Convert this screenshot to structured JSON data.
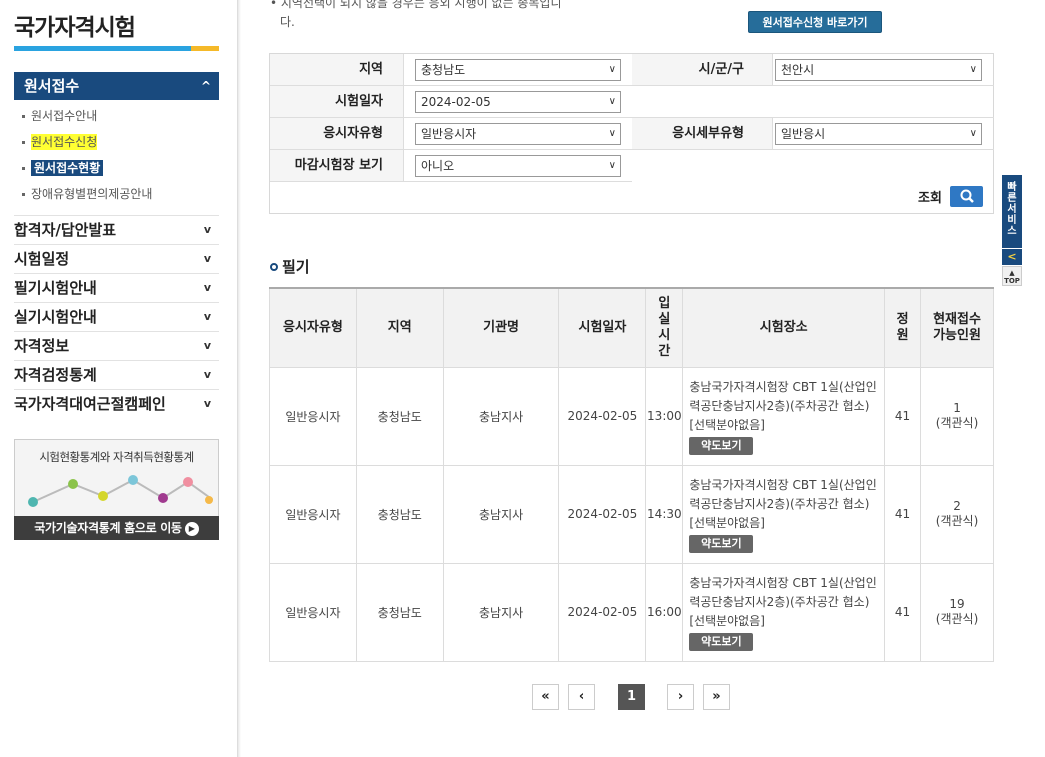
{
  "sidebar": {
    "title": "국가자격시험",
    "active_menu": "원서접수",
    "sub_items": [
      "원서접수안내",
      "원서접수신청",
      "원서접수현황",
      "장애유형별편의제공안내"
    ],
    "menus": [
      "합격자/답안발표",
      "시험일정",
      "필기시험안내",
      "실기시험안내",
      "자격정보",
      "자격검정통계",
      "국가자격대여근절캠페인"
    ],
    "banner_text": "시험현황통계와 자격취득현황통계",
    "banner_link": "국가기술자격통계 홈으로 이동"
  },
  "notice": {
    "line1": "• 지역선택이 되지 않을 경우는 응외 시행이 없는 종목입니",
    "line2": "다."
  },
  "shortcut_button": "원서접수신청 바로가기",
  "filter": {
    "region_label": "지역",
    "region_value": "충청남도",
    "city_label": "시/군/구",
    "city_value": "천안시",
    "date_label": "시험일자",
    "date_value": "2024-02-05",
    "type_label": "응시자유형",
    "type_value": "일반응시자",
    "subtype_label": "응시세부유형",
    "subtype_value": "일반응시",
    "closed_label": "마감시험장 보기",
    "closed_value": "아니오",
    "search_label": "조회"
  },
  "section_title": "필기",
  "table": {
    "headers": [
      "응시자유형",
      "지역",
      "기관명",
      "시험일자",
      "입실시간",
      "시험장소",
      "정원",
      "현재접수가능인원"
    ],
    "rows": [
      {
        "type": "일반응시자",
        "region": "충청남도",
        "org": "충남지사",
        "date": "2024-02-05",
        "time": "13:00",
        "place1": "충남국가자격시험장 CBT 1실(산업인",
        "place2": "력공단충남지사2층)(주차공간 협소)",
        "place3": "[선택분야없음]",
        "map": "약도보기",
        "capacity": "41",
        "avail": "1",
        "avail_note": "(객관식)"
      },
      {
        "type": "일반응시자",
        "region": "충청남도",
        "org": "충남지사",
        "date": "2024-02-05",
        "time": "14:30",
        "place1": "충남국가자격시험장 CBT 1실(산업인",
        "place2": "력공단충남지사2층)(주차공간 협소)",
        "place3": "[선택분야없음]",
        "map": "약도보기",
        "capacity": "41",
        "avail": "2",
        "avail_note": "(객관식)"
      },
      {
        "type": "일반응시자",
        "region": "충청남도",
        "org": "충남지사",
        "date": "2024-02-05",
        "time": "16:00",
        "place1": "충남국가자격시험장 CBT 1실(산업인",
        "place2": "력공단충남지사2층)(주차공간 협소)",
        "place3": "[선택분야없음]",
        "map": "약도보기",
        "capacity": "41",
        "avail": "19",
        "avail_note": "(객관식)"
      }
    ]
  },
  "pagination": {
    "first": "«",
    "prev": "‹",
    "current": "1",
    "next": "›",
    "last": "»"
  },
  "quick": {
    "label": "빠른서비스",
    "toggle": "<",
    "top": "TOP"
  }
}
